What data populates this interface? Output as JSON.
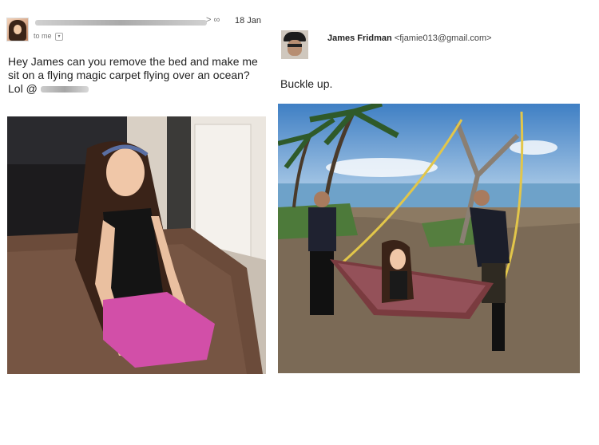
{
  "email": {
    "date": "18 Jan",
    "to_me": "to me",
    "message": "Hey James can you remove the bed and make me sit on a flying magic carpet flying over an ocean? Lol @"
  },
  "reply": {
    "sender_name": "James Fridman",
    "sender_email": "<fjamie013@gmail.com>",
    "text": "Buckle up."
  },
  "icons": {
    "dropdown": "chevron-down-icon",
    "link": "link-icon"
  }
}
